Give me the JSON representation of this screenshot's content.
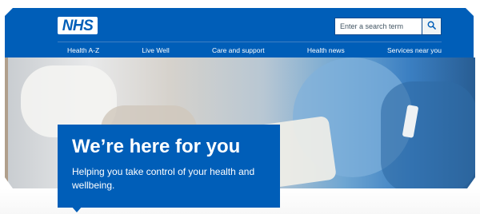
{
  "header": {
    "logo_text": "NHS",
    "search": {
      "placeholder": "Enter a search term",
      "button_icon": "search-icon"
    },
    "nav": [
      "Health A-Z",
      "Live Well",
      "Care and support",
      "Health news",
      "Services near you"
    ]
  },
  "hero": {
    "title": "We’re here for you",
    "subtitle": "Helping you take control of your health and wellbeing."
  },
  "colors": {
    "brand_blue": "#005eb8",
    "white": "#ffffff"
  }
}
